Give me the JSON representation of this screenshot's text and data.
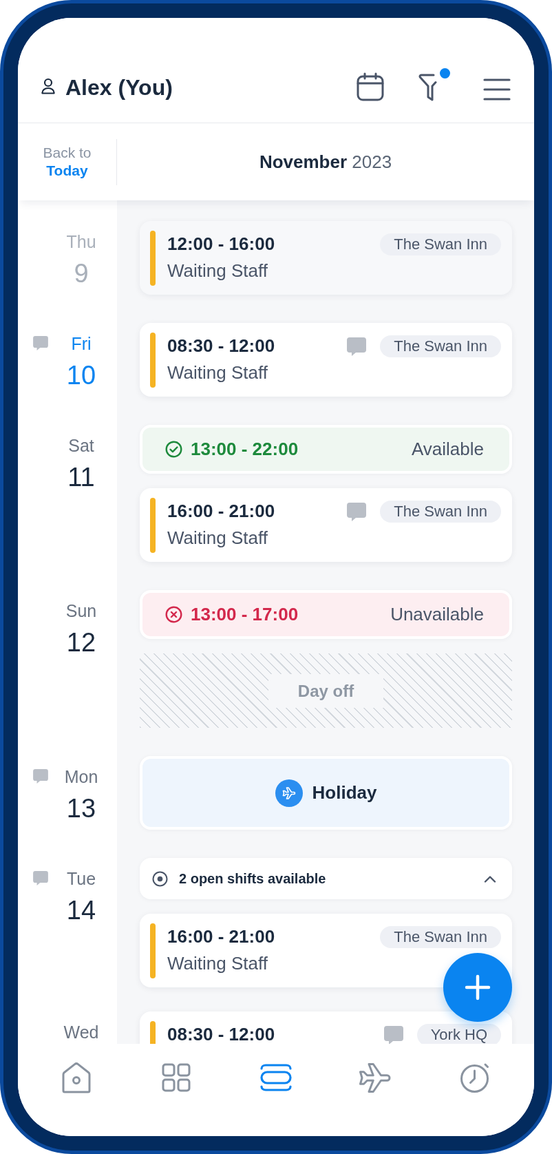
{
  "header": {
    "user_name": "Alex (You)",
    "filters_applied": true
  },
  "date_bar": {
    "back_label": "Back to",
    "today_label": "Today",
    "month_title": "**November** 2023"
  },
  "days": [
    {
      "weekday": "Thu",
      "date": "9",
      "past": true,
      "today": false,
      "has_note": false,
      "entries": [
        {
          "kind": "shift",
          "time": "12:00 - 16:00",
          "role": "Waiting Staff",
          "location": "The Swan Inn",
          "has_comment": false
        }
      ]
    },
    {
      "weekday": "Fri",
      "date": "10",
      "past": false,
      "today": true,
      "has_note": true,
      "entries": [
        {
          "kind": "shift",
          "time": "08:30 - 12:00",
          "role": "Waiting Staff",
          "location": "The Swan Inn",
          "has_comment": true
        }
      ]
    },
    {
      "weekday": "Sat",
      "date": "11",
      "past": false,
      "today": false,
      "has_note": false,
      "entries": [
        {
          "kind": "available",
          "time": "13:00 - 22:00",
          "label": "Available"
        },
        {
          "kind": "shift",
          "time": "16:00 - 21:00",
          "role": "Waiting Staff",
          "location": "The Swan Inn",
          "has_comment": true
        }
      ]
    },
    {
      "weekday": "Sun",
      "date": "12",
      "past": false,
      "today": false,
      "has_note": false,
      "entries": [
        {
          "kind": "unavailable",
          "time": "13:00 - 17:00",
          "label": "Unavailable"
        },
        {
          "kind": "day_off",
          "label": "Day off"
        }
      ]
    },
    {
      "weekday": "Mon",
      "date": "13",
      "past": false,
      "today": false,
      "has_note": true,
      "entries": [
        {
          "kind": "holiday",
          "label": "Holiday"
        }
      ]
    },
    {
      "weekday": "Tue",
      "date": "14",
      "past": false,
      "today": false,
      "has_note": true,
      "entries": [
        {
          "kind": "open_shifts",
          "label": "2 open shifts available",
          "expanded": true
        },
        {
          "kind": "shift",
          "time": "16:00 - 21:00",
          "role": "Waiting Staff",
          "location": "The Swan Inn",
          "has_comment": false
        }
      ]
    },
    {
      "weekday": "Wed",
      "past": false,
      "today": false,
      "has_note": false,
      "entries": [
        {
          "kind": "shift",
          "time": "08:30 - 12:00",
          "location": "York HQ",
          "has_comment": true
        }
      ]
    }
  ],
  "nav": {
    "items": [
      {
        "selected": false
      },
      {
        "selected": false
      },
      {
        "selected": true
      },
      {
        "selected": false
      },
      {
        "selected": false
      }
    ]
  }
}
